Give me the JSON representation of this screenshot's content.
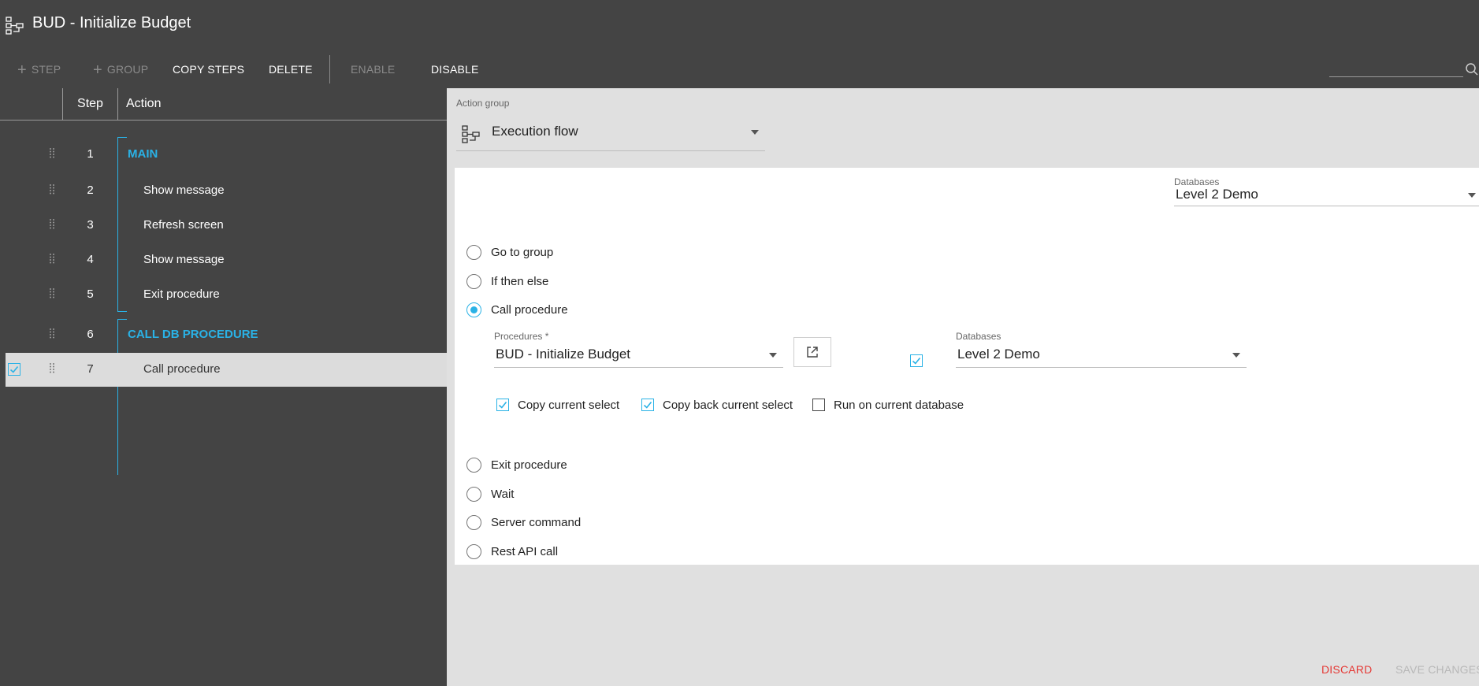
{
  "header": {
    "title": "BUD - Initialize Budget",
    "icon": "flow-icon"
  },
  "toolbar": {
    "step_label": "STEP",
    "group_label": "GROUP",
    "copy_steps_label": "COPY STEPS",
    "delete_label": "DELETE",
    "enable_label": "ENABLE",
    "disable_label": "DISABLE",
    "search_placeholder": ""
  },
  "grid": {
    "columns": [
      "Step",
      "Action"
    ],
    "rows": [
      {
        "step": "1",
        "action": "MAIN",
        "type": "group"
      },
      {
        "step": "2",
        "action": "Show message",
        "type": "item"
      },
      {
        "step": "3",
        "action": "Refresh screen",
        "type": "item"
      },
      {
        "step": "4",
        "action": "Show message",
        "type": "item"
      },
      {
        "step": "5",
        "action": "Exit procedure",
        "type": "item"
      },
      {
        "step": "6",
        "action": "CALL DB PROCEDURE",
        "type": "group"
      },
      {
        "step": "7",
        "action": "Call procedure",
        "type": "item",
        "selected": true
      }
    ]
  },
  "detail": {
    "action_group_label": "Action group",
    "action_group_value": "Execution flow",
    "databases_label": "Databases",
    "databases_value": "Level 2 Demo",
    "options": [
      {
        "label": "Go to group",
        "selected": false
      },
      {
        "label": "If then else",
        "selected": false
      },
      {
        "label": "Call procedure",
        "selected": true
      },
      {
        "label": "Exit procedure",
        "selected": false
      },
      {
        "label": "Wait",
        "selected": false
      },
      {
        "label": "Server command",
        "selected": false
      },
      {
        "label": "Rest API call",
        "selected": false
      }
    ],
    "call": {
      "procedures_label": "Procedures *",
      "procedures_value": "BUD - Initialize Budget",
      "databases_label": "Databases",
      "databases_value": "Level 2 Demo",
      "databases_checked": true,
      "copy_current_select": {
        "label": "Copy current select",
        "checked": true
      },
      "copy_back_current_select": {
        "label": "Copy back current select",
        "checked": true
      },
      "run_on_current_database": {
        "label": "Run on current database",
        "checked": false
      }
    }
  },
  "footer": {
    "discard_label": "DISCARD",
    "save_label": "SAVE CHANGES"
  },
  "colors": {
    "accent": "#2ab2e6",
    "background": "#444444",
    "panel": "#e0e0e0",
    "danger": "#e53935"
  }
}
